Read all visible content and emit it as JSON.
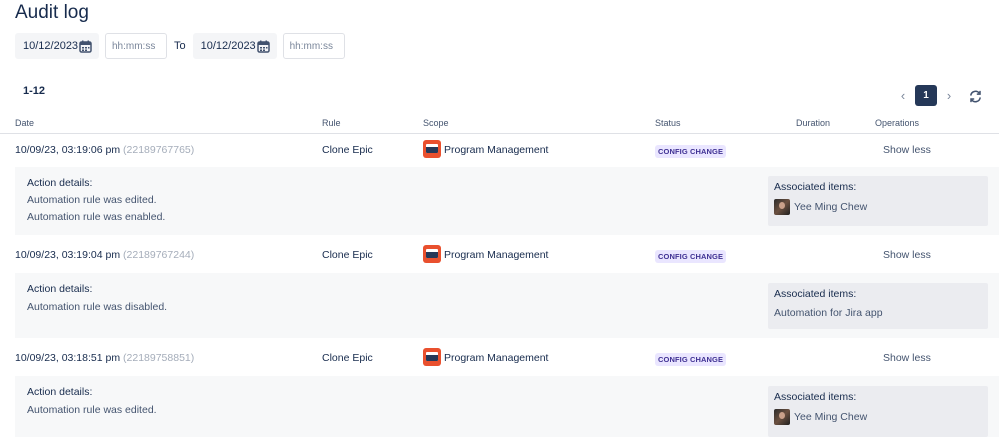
{
  "page_title": "Audit log",
  "filters": {
    "from_date": "10/12/2023",
    "from_time_placeholder": "hh:mm:ss",
    "to_label": "To",
    "to_date": "10/12/2023",
    "to_time_placeholder": "hh:mm:ss"
  },
  "range_label": "1-12",
  "pagination": {
    "prev": "‹",
    "current": "1",
    "next": "›"
  },
  "columns": {
    "date": "Date",
    "rule": "Rule",
    "scope": "Scope",
    "status": "Status",
    "duration": "Duration",
    "operations": "Operations"
  },
  "entries": [
    {
      "date": "10/09/23, 03:19:06 pm",
      "id": "(22189767765)",
      "rule": "Clone Epic",
      "scope": "Program Management",
      "status": "CONFIG CHANGE",
      "operation": "Show less",
      "details_title": "Action details:",
      "details": [
        "Automation rule was edited.",
        "Automation rule was enabled."
      ],
      "assoc_title": "Associated items:",
      "assoc_item": "Yee Ming Chew"
    },
    {
      "date": "10/09/23, 03:19:04 pm",
      "id": "(22189767244)",
      "rule": "Clone Epic",
      "scope": "Program Management",
      "status": "CONFIG CHANGE",
      "operation": "Show less",
      "details_title": "Action details:",
      "details": [
        "Automation rule was disabled."
      ],
      "assoc_title": "Associated items:",
      "assoc_item": "Automation for Jira app"
    },
    {
      "date": "10/09/23, 03:18:51 pm",
      "id": "(22189758851)",
      "rule": "Clone Epic",
      "scope": "Program Management",
      "status": "CONFIG CHANGE",
      "operation": "Show less",
      "details_title": "Action details:",
      "details": [
        "Automation rule was edited."
      ],
      "assoc_title": "Associated items:",
      "assoc_item": "Yee Ming Chew"
    }
  ],
  "colors": {
    "badge_bg": "#eae6ff",
    "badge_text": "#403294",
    "scope_icon": "#e9502e",
    "page_button": "#253858"
  }
}
